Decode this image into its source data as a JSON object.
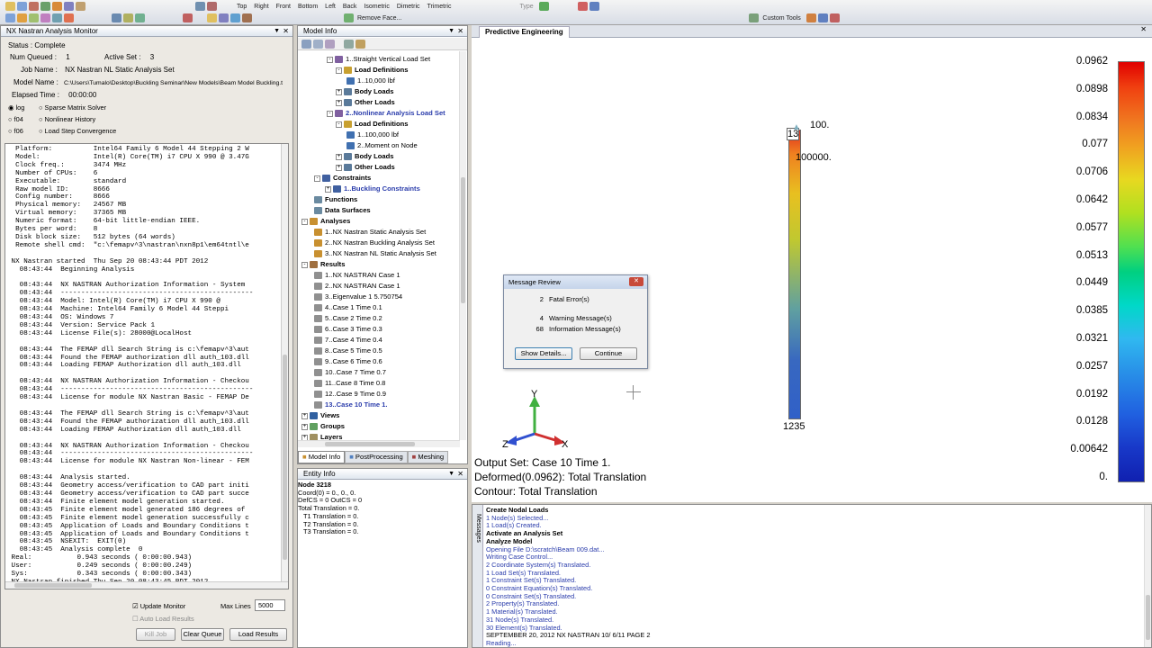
{
  "toolbar": {
    "view_items": [
      "Top",
      "Right",
      "Front",
      "Bottom",
      "Left",
      "Back",
      "Isometric",
      "Dimetric",
      "Trimetric"
    ],
    "remove_face_label": "Remove Face...",
    "type_label": "Type",
    "custom_tools_label": "Custom Tools"
  },
  "monitor": {
    "title": "NX Nastran Analysis Monitor",
    "status_label": "Status :",
    "status_value": "Complete",
    "num_queued_label": "Num Queued :",
    "num_queued_value": "1",
    "active_set_label": "Active Set :",
    "active_set_value": "3",
    "job_name_label": "Job Name :",
    "job_name_value": "NX Nastran NL Static Analysis Set",
    "model_name_label": "Model Name :",
    "model_name_value": "C:\\Users\\Tumalo\\Desktop\\Buckling Seminar\\New Models\\Beam Model Buckling.t",
    "elapsed_label": "Elapsed Time :",
    "elapsed_value": "00:00:00",
    "radios": [
      "log",
      "Sparse Matrix Solver",
      "f04",
      "Nonlinear History",
      "f06",
      "Load Step Convergence"
    ],
    "log_text": "  Platform:          Intel64 Family 6 Model 44 Stepping 2 W\n  Model:             Intel(R) Core(TM) i7 CPU X 990 @ 3.47G\n  Clock freq.:       3474 MHz\n  Number of CPUs:    6\n  Executable:        standard\n  Raw model ID:      8666\n  Config number:     8666\n  Physical memory:   24567 MB\n  Virtual memory:    37365 MB\n  Numeric format:    64-bit little-endian IEEE.\n  Bytes per word:    8\n  Disk block size:   512 bytes (64 words)\n  Remote shell cmd:  \"c:\\femapv^3\\nastran\\nxn8p1\\em64tntl\\e\n\n NX Nastran started  Thu Sep 20 08:43:44 PDT 2012\n   08:43:44  Beginning Analysis\n\n   08:43:44  NX NASTRAN Authorization Information - System\n   08:43:44  -----------------------------------------------\n   08:43:44  Model: Intel(R) Core(TM) i7 CPU X 990 @\n   08:43:44  Machine: Intel64 Family 6 Model 44 Steppi\n   08:43:44  OS: Windows 7\n   08:43:44  Version: Service Pack 1\n   08:43:44  License File(s): 28000@LocalHost\n\n   08:43:44  The FEMAP dll Search String is c:\\femapv^3\\aut\n   08:43:44  Found the FEMAP authorization dll auth_103.dll\n   08:43:44  Loading FEMAP Authorization dll auth_103.dll\n\n   08:43:44  NX NASTRAN Authorization Information - Checkou\n   08:43:44  -----------------------------------------------\n   08:43:44  License for module NX Nastran Basic - FEMAP De\n\n   08:43:44  The FEMAP dll Search String is c:\\femapv^3\\aut\n   08:43:44  Found the FEMAP authorization dll auth_103.dll\n   08:43:44  Loading FEMAP Authorization dll auth_103.dll\n\n   08:43:44  NX NASTRAN Authorization Information - Checkou\n   08:43:44  -----------------------------------------------\n   08:43:44  License for module NX Nastran Non-linear - FEM\n\n   08:43:44  Analysis started.\n   08:43:44  Geometry access/verification to CAD part initi\n   08:43:44  Geometry access/verification to CAD part succe\n   08:43:44  Finite element model generation started.\n   08:43:45  Finite element model generated 186 degrees of\n   08:43:45  Finite element model generation successfully c\n   08:43:45  Application of Loads and Boundary Conditions t\n   08:43:45  Application of Loads and Boundary Conditions t\n   08:43:45  NSEXIT:  EXIT(0)\n   08:43:45  Analysis complete  0\n Real:           0.943 seconds ( 0:00:00.943)\n User:           0.249 seconds ( 0:00:00.249)\n Sys:            0.343 seconds ( 0:00:00.343)\n NX Nastran finished Thu Sep 20 08:43:45 PDT 2012",
    "update_monitor_label": "Update Monitor",
    "auto_load_label": "Auto Load Results",
    "max_lines_label": "Max Lines",
    "max_lines_value": "5000",
    "kill_job_label": "Kill Job",
    "clear_queue_label": "Clear Queue",
    "load_results_label": "Load Results"
  },
  "model_info": {
    "title": "Model Info",
    "tree": [
      {
        "label": "1..Straight Vertical Load Set",
        "style": "normal"
      },
      {
        "label": "Load Definitions",
        "style": "bold"
      },
      {
        "label": "1..10,000 lbf",
        "style": "normal"
      },
      {
        "label": "Body Loads",
        "style": "bold"
      },
      {
        "label": "Other Loads",
        "style": "bold"
      },
      {
        "label": "2..Nonlinear Analysis Load Set",
        "style": "blue"
      },
      {
        "label": "Load Definitions",
        "style": "bold"
      },
      {
        "label": "1..100,000 lbf",
        "style": "normal"
      },
      {
        "label": "2..Moment on Node",
        "style": "normal"
      },
      {
        "label": "Body Loads",
        "style": "bold"
      },
      {
        "label": "Other Loads",
        "style": "bold"
      },
      {
        "label": "Constraints",
        "style": "bold"
      },
      {
        "label": "1..Buckling Constraints",
        "style": "blue"
      },
      {
        "label": "Functions",
        "style": "bold"
      },
      {
        "label": "Data Surfaces",
        "style": "bold"
      },
      {
        "label": "Analyses",
        "style": "bold"
      },
      {
        "label": "1..NX Nastran Static Analysis Set",
        "style": "normal"
      },
      {
        "label": "2..NX Nastran Buckling Analysis Set",
        "style": "normal"
      },
      {
        "label": "3..NX Nastran NL Static Analysis Set",
        "style": "normal"
      },
      {
        "label": "Results",
        "style": "bold"
      },
      {
        "label": "1..NX NASTRAN Case 1",
        "style": "normal"
      },
      {
        "label": "2..NX NASTRAN Case 1",
        "style": "normal"
      },
      {
        "label": "3..Eigenvalue 1 5.750754",
        "style": "normal"
      },
      {
        "label": "4..Case 1 Time 0.1",
        "style": "normal"
      },
      {
        "label": "5..Case 2 Time 0.2",
        "style": "normal"
      },
      {
        "label": "6..Case 3 Time 0.3",
        "style": "normal"
      },
      {
        "label": "7..Case 4 Time 0.4",
        "style": "normal"
      },
      {
        "label": "8..Case 5 Time 0.5",
        "style": "normal"
      },
      {
        "label": "9..Case 6 Time 0.6",
        "style": "normal"
      },
      {
        "label": "10..Case 7 Time 0.7",
        "style": "normal"
      },
      {
        "label": "11..Case 8 Time 0.8",
        "style": "normal"
      },
      {
        "label": "12..Case 9 Time 0.9",
        "style": "normal"
      },
      {
        "label": "13..Case 10 Time 1.",
        "style": "blue"
      },
      {
        "label": "Views",
        "style": "bold"
      },
      {
        "label": "Groups",
        "style": "bold"
      },
      {
        "label": "Layers",
        "style": "bold"
      }
    ],
    "tabs": [
      "Model Info",
      "PostProcessing",
      "Meshing"
    ]
  },
  "entity_info": {
    "title": "Entity Info",
    "lines": [
      "Node 3218",
      "Coord(0) = 0., 0., 0.",
      "DefCS = 0 OutCS = 0",
      "Total Translation = 0.",
      "T1 Translation = 0.",
      "T2 Translation = 0.",
      "T3 Translation = 0."
    ]
  },
  "viewport": {
    "tab_label": "Predictive Engineering",
    "label_100": "100.",
    "label_13": "13",
    "label_100000": "100000.",
    "label_1235": "1235",
    "axis_y": "Y",
    "axis_x": "X",
    "axis_z": "Z",
    "output_set": "Output Set: Case 10 Time 1.",
    "deformed": "Deformed(0.0962): Total Translation",
    "contour": "Contour: Total Translation",
    "colorbar_labels": [
      "0.0962",
      "0.0898",
      "0.0834",
      "0.077",
      "0.0706",
      "0.0642",
      "0.0577",
      "0.0513",
      "0.0449",
      "0.0385",
      "0.0321",
      "0.0257",
      "0.0192",
      "0.0128",
      "0.00642",
      "0."
    ]
  },
  "dialog": {
    "title": "Message Review",
    "rows": [
      {
        "count": "2",
        "label": "Fatal Error(s)"
      },
      {
        "count": "4",
        "label": "Warning Message(s)"
      },
      {
        "count": "68",
        "label": "Information Message(s)"
      }
    ],
    "show_details_label": "Show Details...",
    "continue_label": "Continue"
  },
  "messages": {
    "tab_label": "Messages",
    "lines": [
      {
        "text": "Create Nodal Loads",
        "style": "bold"
      },
      {
        "text": "1 Node(s) Selected...",
        "style": "blue"
      },
      {
        "text": "1 Load(s) Created.",
        "style": "blue"
      },
      {
        "text": "Activate an Analysis Set",
        "style": "bold"
      },
      {
        "text": "Analyze Model",
        "style": "bold"
      },
      {
        "text": "Opening File D:\\scratch\\Beam 009.dat...",
        "style": "blue"
      },
      {
        "text": "Writing Case Control...",
        "style": "blue"
      },
      {
        "text": "2 Coordinate System(s) Translated.",
        "style": "blue"
      },
      {
        "text": "1 Load Set(s) Translated.",
        "style": "blue"
      },
      {
        "text": "1 Constraint Set(s) Translated.",
        "style": "blue"
      },
      {
        "text": "0 Constraint Equation(s) Translated.",
        "style": "blue"
      },
      {
        "text": "0 Constraint Set(s) Translated.",
        "style": "blue"
      },
      {
        "text": "2 Property(s) Translated.",
        "style": "blue"
      },
      {
        "text": "1 Material(s) Translated.",
        "style": "blue"
      },
      {
        "text": "31 Node(s) Translated.",
        "style": "blue"
      },
      {
        "text": "30 Element(s) Translated.",
        "style": "blue"
      },
      {
        "text": "SEPTEMBER  20, 2012  NX NASTRAN 10/ 6/11   PAGE     2",
        "style": "normal"
      },
      {
        "text": "Reading...",
        "style": "blue"
      }
    ]
  },
  "colors": {
    "bar_top": "#e0301e",
    "bar_bottom": "#3060c8"
  }
}
